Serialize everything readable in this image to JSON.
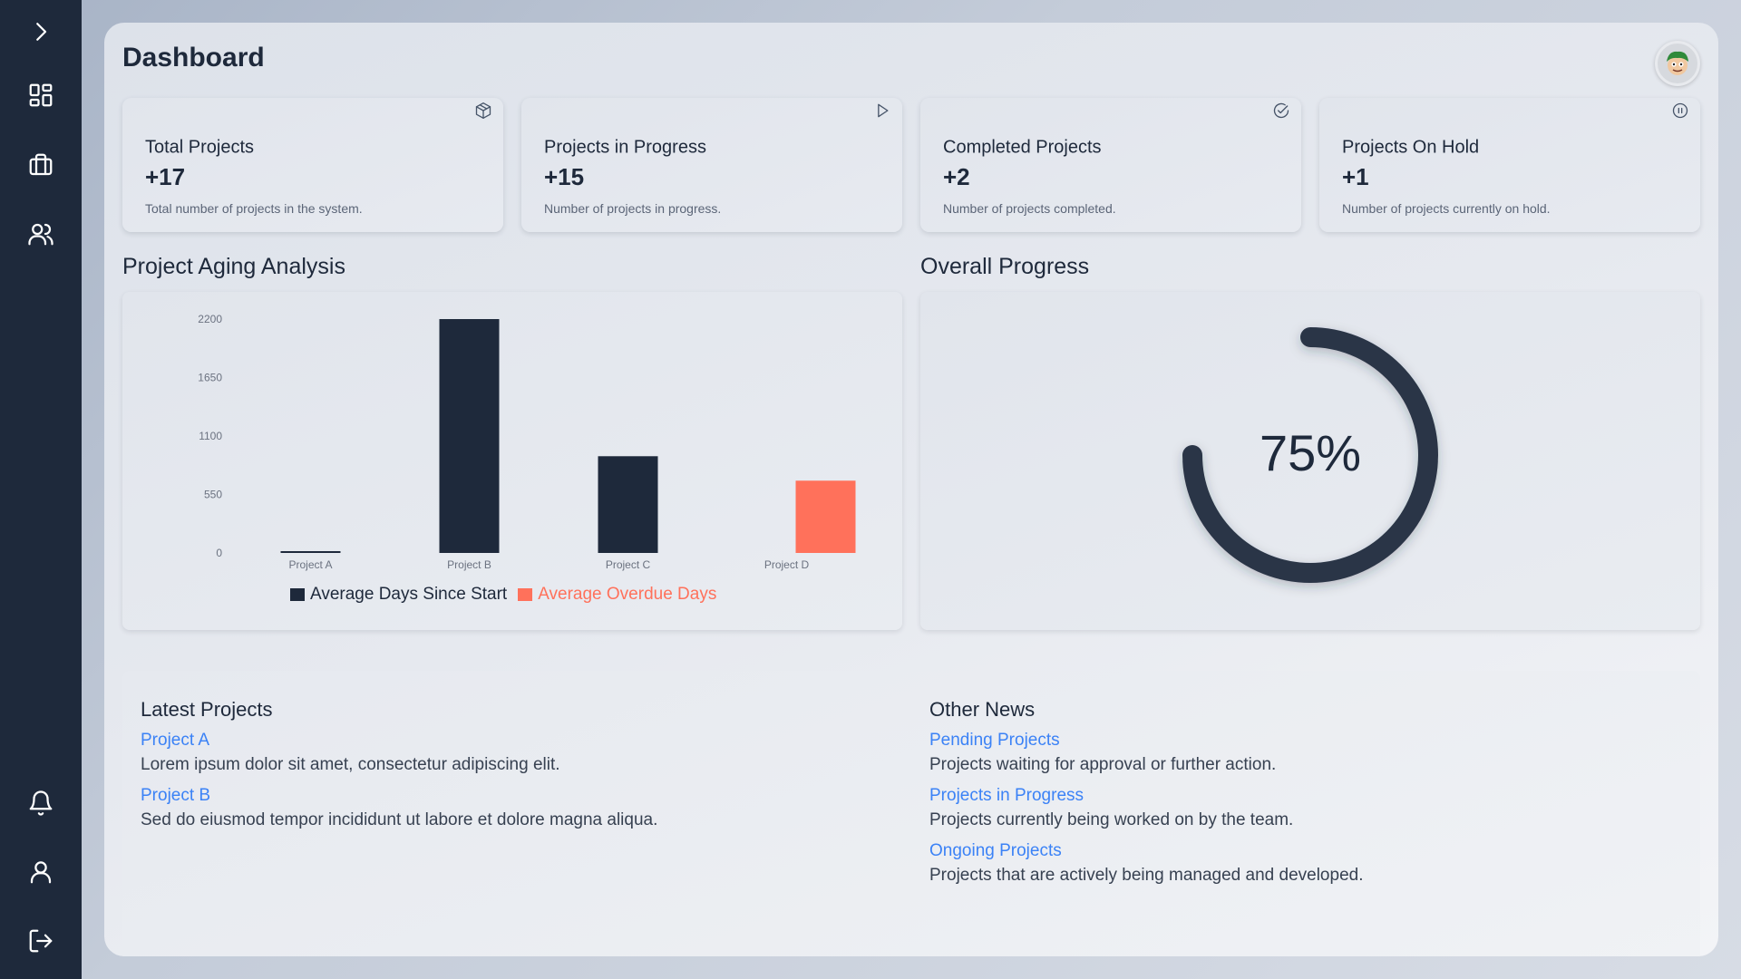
{
  "sidebar": {
    "icons": [
      "chevron-right-icon",
      "dashboard-icon",
      "briefcase-icon",
      "users-icon",
      "bell-icon",
      "user-icon",
      "logout-icon"
    ]
  },
  "header": {
    "title": "Dashboard"
  },
  "cards": [
    {
      "title": "Total Projects",
      "value": "+17",
      "desc": "Total number of projects in the system.",
      "icon": "package-icon"
    },
    {
      "title": "Projects in Progress",
      "value": "+15",
      "desc": "Number of projects in progress.",
      "icon": "play-icon"
    },
    {
      "title": "Completed Projects",
      "value": "+2",
      "desc": "Number of projects completed.",
      "icon": "check-circle-icon"
    },
    {
      "title": "Projects On Hold",
      "value": "+1",
      "desc": "Number of projects currently on hold.",
      "icon": "pause-circle-icon"
    }
  ],
  "aging": {
    "title": "Project Aging Analysis",
    "chart_data": {
      "type": "bar",
      "categories": [
        "Project A",
        "Project B",
        "Project C",
        "Project D"
      ],
      "series": [
        {
          "name": "Average Days Since Start",
          "values": [
            15,
            2200,
            910,
            0
          ],
          "color": "#1e293b"
        },
        {
          "name": "Average Overdue Days",
          "values": [
            0,
            0,
            0,
            680
          ],
          "color": "#ff715b"
        }
      ],
      "yticks": [
        0,
        550,
        1100,
        1650,
        2200
      ],
      "ylim": [
        0,
        2200
      ],
      "legend": "bottom"
    }
  },
  "progress": {
    "title": "Overall Progress",
    "value": 75,
    "label": "75%"
  },
  "latest": {
    "title": "Latest Projects",
    "items": [
      {
        "link": "Project A",
        "text": "Lorem ipsum dolor sit amet, consectetur adipiscing elit."
      },
      {
        "link": "Project B",
        "text": "Sed do eiusmod tempor incididunt ut labore et dolore magna aliqua."
      }
    ]
  },
  "other_news": {
    "title": "Other News",
    "items": [
      {
        "link": "Pending Projects",
        "text": "Projects waiting for approval or further action."
      },
      {
        "link": "Projects in Progress",
        "text": "Projects currently being worked on by the team."
      },
      {
        "link": "Ongoing Projects",
        "text": "Projects that are actively being managed and developed."
      }
    ]
  }
}
